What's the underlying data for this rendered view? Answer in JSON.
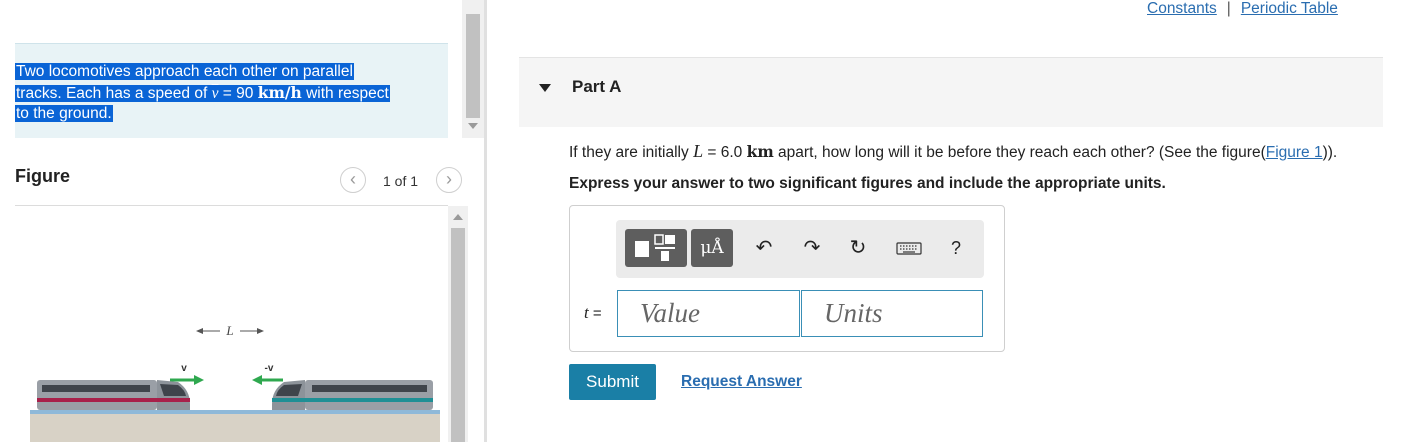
{
  "header": {
    "constants_link": "Constants",
    "periodic_table_link": "Periodic Table",
    "separator": "|"
  },
  "problem": {
    "line1": "Two locomotives approach each other on parallel",
    "line2_a": "tracks. Each has a speed of ",
    "speed_symbol": "v",
    "speed_eq": " = 90 ",
    "speed_unit": "km/h",
    "line2_b": " with respect",
    "line3": "to the ground."
  },
  "figure": {
    "title": "Figure",
    "counter": "1 of 1",
    "prev_icon": "chevron-left-icon",
    "next_icon": "chevron-right-icon",
    "label_L": "L",
    "label_v": "v",
    "label_neg_v": "-v"
  },
  "part": {
    "title": "Part A",
    "question_prefix": "If they are initially ",
    "question_var": "L",
    "question_eq": " = 6.0 ",
    "question_unit": "km",
    "question_suffix": " apart, how long will it be before they reach each other? (See the figure(",
    "figure_link": "Figure 1",
    "question_end": ")).",
    "instruction": "Express your answer to two significant figures and include the appropriate units."
  },
  "answer": {
    "var_label": "t",
    "equals": "=",
    "value_placeholder": "Value",
    "units_placeholder": "Units",
    "units_tool_label": "μÅ",
    "help_label": "?"
  },
  "actions": {
    "submit": "Submit",
    "request_answer": "Request Answer"
  },
  "colors": {
    "link": "#2a6db0",
    "submit": "#1a7fa6",
    "selection": "#0a64d6",
    "problem_bg": "#e8f3f6"
  }
}
